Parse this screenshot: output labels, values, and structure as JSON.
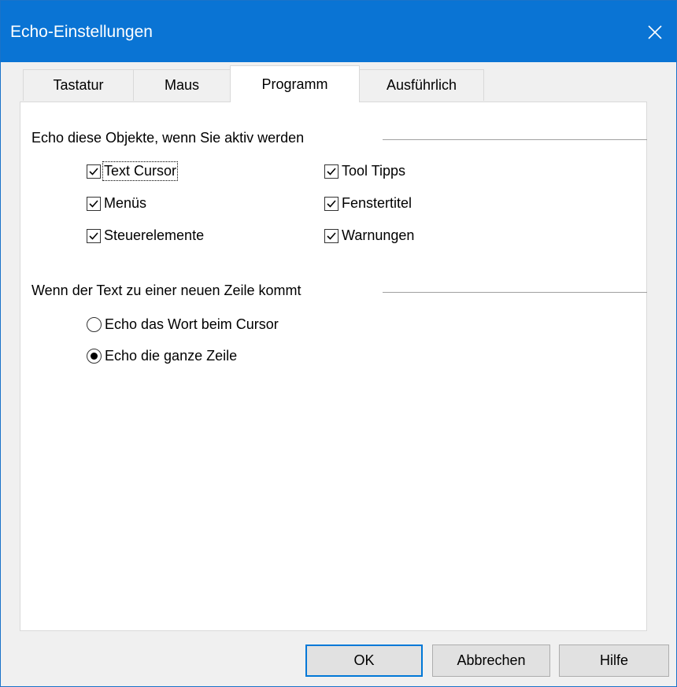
{
  "window": {
    "title": "Echo-Einstellungen",
    "accent_color": "#0a74d4"
  },
  "tabs": [
    {
      "label": "Tastatur",
      "active": false
    },
    {
      "label": "Maus",
      "active": false
    },
    {
      "label": "Programm",
      "active": true
    },
    {
      "label": "Ausführlich",
      "active": false
    }
  ],
  "group_objects": {
    "label": "Echo diese Objekte, wenn Sie aktiv werden",
    "options": [
      {
        "label": "Text Cursor",
        "checked": true
      },
      {
        "label": "Tool Tipps",
        "checked": true
      },
      {
        "label": "Menüs",
        "checked": true
      },
      {
        "label": "Fenstertitel",
        "checked": true
      },
      {
        "label": "Steuerelemente",
        "checked": true
      },
      {
        "label": "Warnungen",
        "checked": true
      }
    ]
  },
  "group_newline": {
    "label": "Wenn der Text zu einer neuen Zeile kommt",
    "options": [
      {
        "label": "Echo das Wort beim Cursor",
        "selected": false
      },
      {
        "label": "Echo die ganze Zeile",
        "selected": true
      }
    ]
  },
  "buttons": {
    "ok": "OK",
    "cancel": "Abbrechen",
    "help": "Hilfe"
  },
  "icons": {
    "close": "close-icon",
    "check": "checkmark-icon"
  }
}
